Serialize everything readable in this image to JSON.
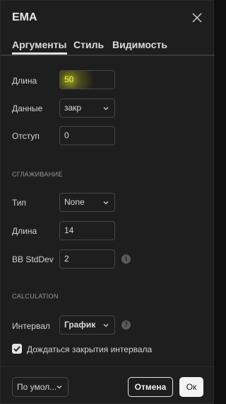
{
  "dialog": {
    "title": "EMA"
  },
  "tabs": [
    {
      "label": "Аргументы",
      "active": true
    },
    {
      "label": "Стиль",
      "active": false
    },
    {
      "label": "Видимость",
      "active": false
    }
  ],
  "arguments": {
    "length_label": "Длина",
    "length_value": "50",
    "source_label": "Данные",
    "source_value": "закр",
    "offset_label": "Отступ",
    "offset_value": "0"
  },
  "smoothing": {
    "section_title": "СГЛАЖИВАНИЕ",
    "type_label": "Тип",
    "type_value": "None",
    "length_label": "Длина",
    "length_value": "14",
    "bb_label": "BB StdDev",
    "bb_value": "2"
  },
  "calculation": {
    "section_title": "CALCULATION",
    "interval_label": "Интервал",
    "interval_value": "График",
    "wait_close_label": "Дождаться закрытия интервала",
    "wait_close_checked": true
  },
  "footer": {
    "defaults_label": "По умол...",
    "cancel_label": "Отмена",
    "ok_label": "Ок"
  },
  "icons": {
    "close": "close-icon",
    "chevron": "chevron-down-icon",
    "info": "info-icon",
    "help": "help-icon",
    "check": "checkmark-icon"
  },
  "colors": {
    "background": "#1e1e1e",
    "highlight": "#e6e63c",
    "text": "#dbdbdb"
  }
}
